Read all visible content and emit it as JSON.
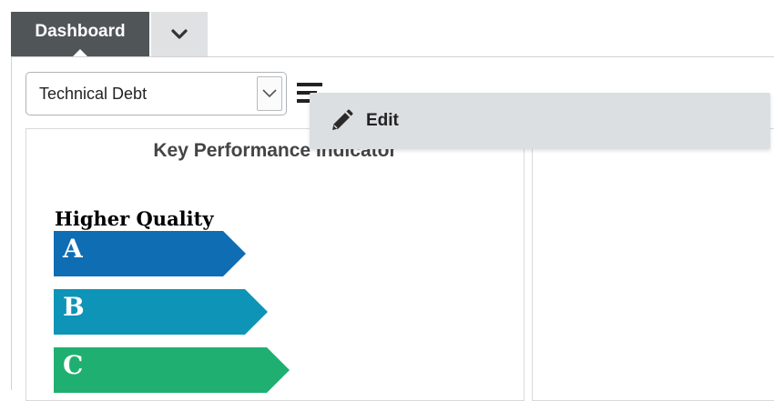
{
  "tabs": {
    "active_label": "Dashboard",
    "dropdown_icon": "chevron-down-icon"
  },
  "selector": {
    "value": "Technical Debt",
    "arrow_icon": "chevron-down-icon"
  },
  "toolbar": {
    "menu_icon": "hamburger-menu-icon"
  },
  "kpi_widget": {
    "title": "Key Performance Indicator",
    "top_label": "Higher Quality",
    "grades": [
      {
        "letter": "A",
        "color": "#0f6db4"
      },
      {
        "letter": "B",
        "color": "#0e94b7"
      },
      {
        "letter": "C",
        "color": "#1fb071"
      }
    ]
  },
  "context_menu": {
    "items": [
      {
        "label": "Edit",
        "icon": "pencil-icon"
      }
    ]
  },
  "colors": {
    "tab_active_bg": "#505558",
    "tab_inactive_bg": "#dfe1e3",
    "menu_bg": "#dcdfe1"
  }
}
